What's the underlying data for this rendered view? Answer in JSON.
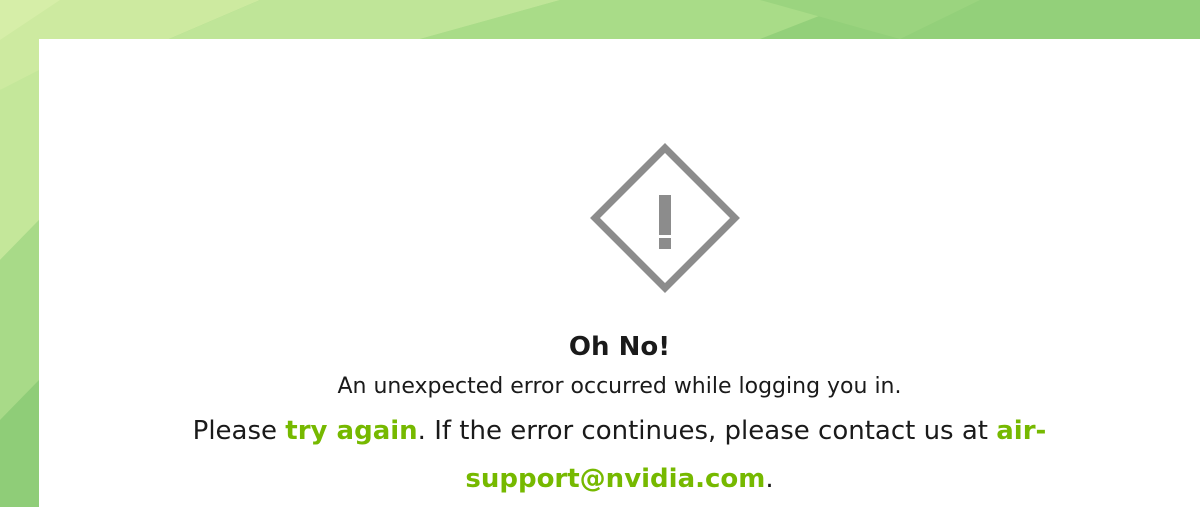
{
  "colors": {
    "accent": "#76b900",
    "icon": "#8c8c8c",
    "text": "#1a1a1a",
    "card": "#ffffff"
  },
  "error": {
    "icon": "warning-diamond-icon",
    "title": "Oh No!",
    "message": "An unexpected error occurred while logging you in.",
    "help_prefix": "Please ",
    "try_again_label": "try again",
    "help_middle": ". If the error continues, please contact us at ",
    "support_email": "air-support@nvidia.com",
    "help_suffix": "."
  }
}
